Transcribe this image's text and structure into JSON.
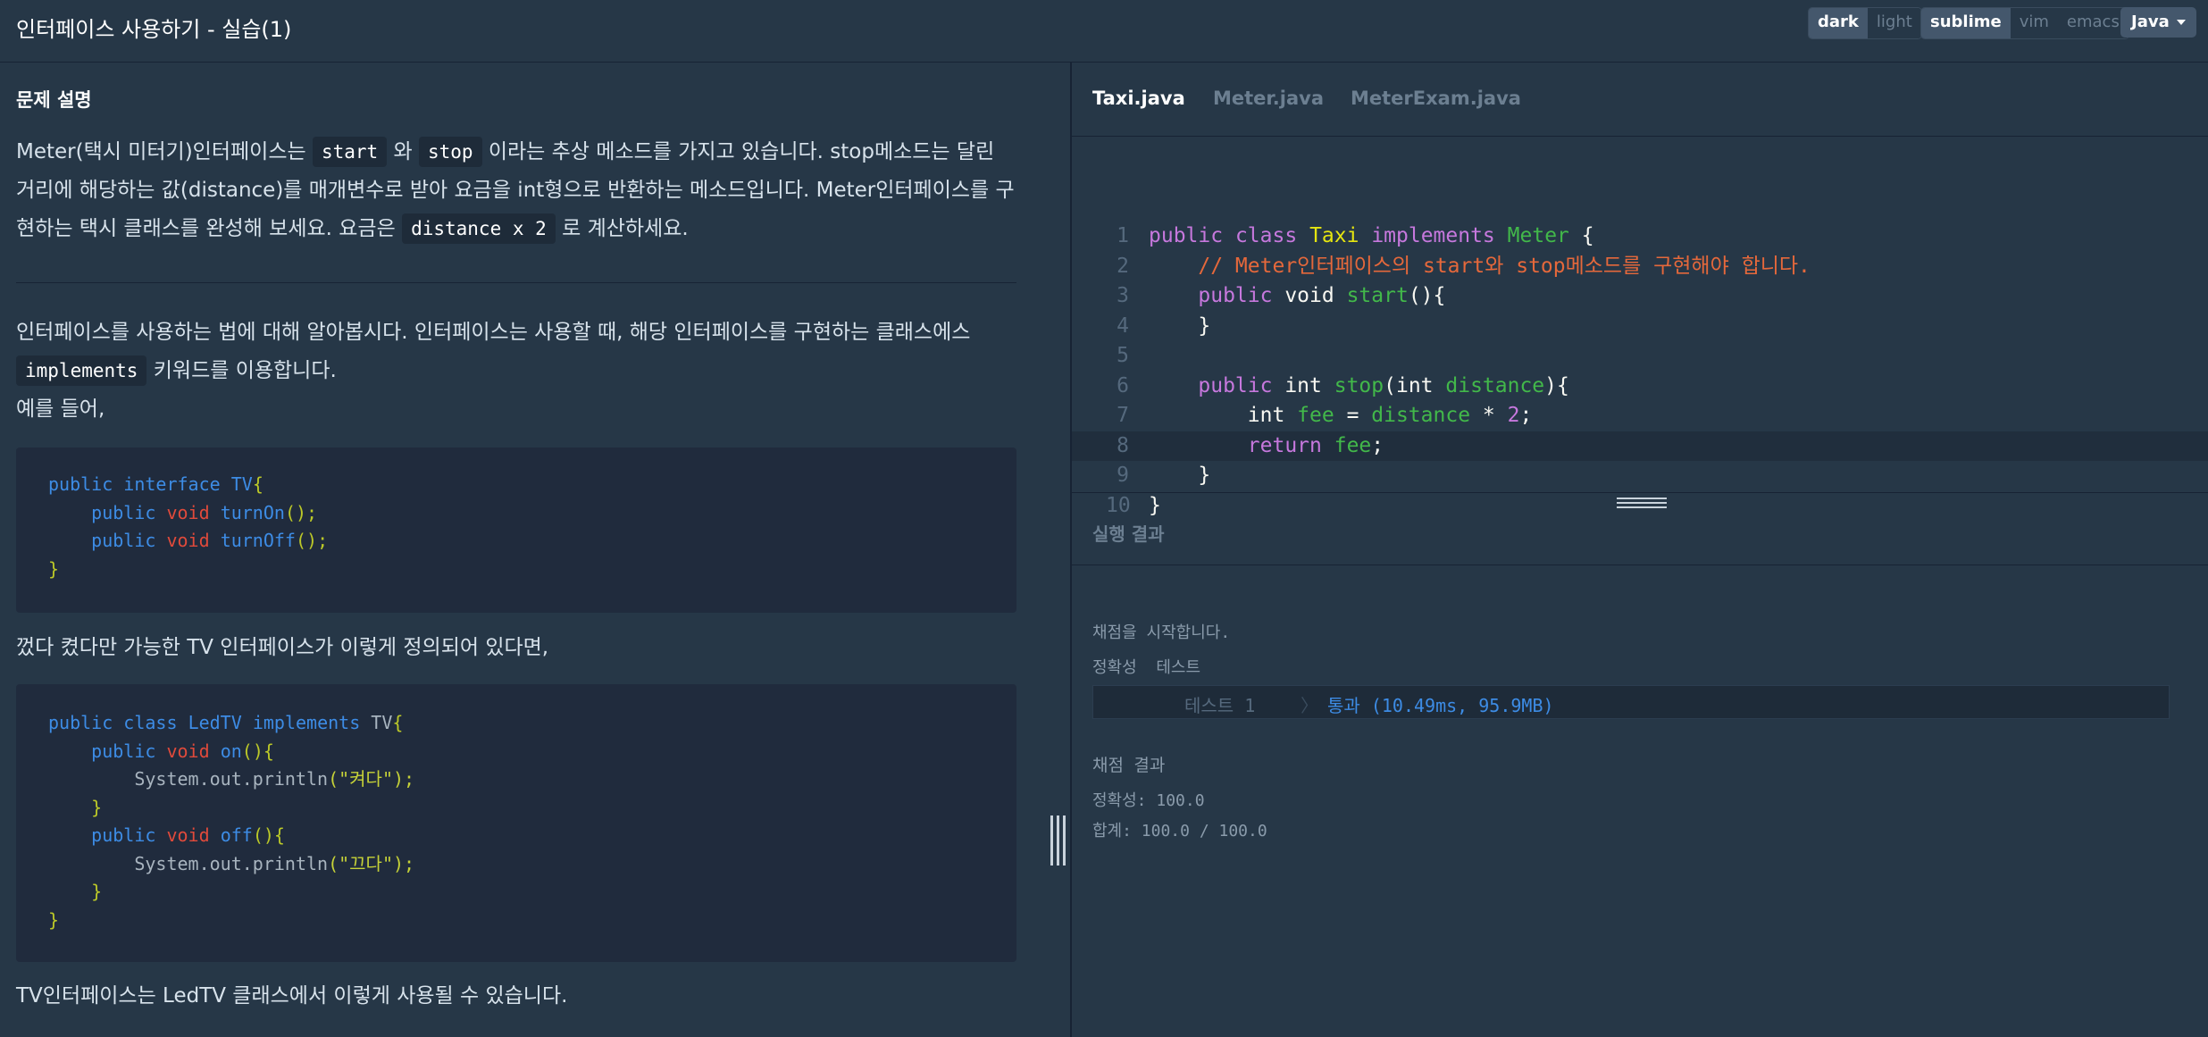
{
  "header": {
    "title": "인터페이스 사용하기 - 실습(1)",
    "theme_options": [
      "dark",
      "light"
    ],
    "keymap_options": [
      "sublime",
      "vim",
      "emacs"
    ],
    "language": "Java"
  },
  "description": {
    "heading": "문제 설명",
    "p1_a": "Meter(택시 미터기)인터페이스는 ",
    "p1_code1": "start",
    "p1_b": " 와 ",
    "p1_code2": "stop",
    "p1_c": " 이라는 추상 메소드를 가지고 있습니다. stop메소드는 달린 거리에 해당하는 값(distance)를 매개변수로 받아 요금을 int형으로 반환하는 메소드입니다. Meter인터페이스를 구현하는 택시 클래스를 완성해 보세요. 요금은 ",
    "p1_code3": "distance x 2",
    "p1_d": " 로 계산하세요.",
    "p2_a": "인터페이스를 사용하는 법에 대해 알아봅시다. 인터페이스는 사용할 때, 해당 인터페이스를 구현하는 클래스에스 ",
    "p2_code": "implements",
    "p2_b": " 키워드를 이용합니다.",
    "p3": "예를 들어,",
    "p4": "껐다 켰다만 가능한 TV 인터페이스가 이렇게 정의되어 있다면,",
    "p5": "TV인터페이스는 LedTV 클래스에서 이렇게 사용될 수 있습니다.",
    "code_tv": {
      "kw_public": "public",
      "kw_interface": "interface",
      "name": "TV",
      "brace_open": "{",
      "void": "void",
      "m1": "turnOn",
      "m2": "turnOff",
      "call": "();",
      "brace_close": "}"
    },
    "code_led": {
      "kw_public": "public",
      "kw_class": "class",
      "name": "LedTV",
      "kw_implements": "implements",
      "iface": "TV",
      "brace_open": "{",
      "void": "void",
      "m_on": "on",
      "m_off": "off",
      "sig": "(){",
      "println": "System.out.println",
      "str_on": "(\"켜다\");",
      "str_off": "(\"끄다\");",
      "brace_close": "}"
    }
  },
  "editor": {
    "tabs": [
      "Taxi.java",
      "Meter.java",
      "MeterExam.java"
    ],
    "line_numbers": [
      "1",
      "2",
      "3",
      "4",
      "5",
      "6",
      "7",
      "8",
      "9",
      "10"
    ],
    "l1": {
      "public": "public",
      "class": "class",
      "name": "Taxi",
      "implements": "implements",
      "iface": "Meter",
      "brace": " {"
    },
    "l2": {
      "comment": "// Meter인터페이스의 start와 stop메소드를 구현해야 합니다."
    },
    "l3": {
      "public": "public",
      "void": " void ",
      "fn": "start",
      "rest": "(){"
    },
    "l4": {
      "brace": "}"
    },
    "l6": {
      "public": "public",
      "int": " int ",
      "fn": "stop",
      "p1": "(int ",
      "arg": "distance",
      "p2": "){"
    },
    "l7": {
      "int": "int ",
      "var": "fee",
      "eq": " = ",
      "arg": "distance",
      "op": " * ",
      "num": "2",
      "semi": ";"
    },
    "l8": {
      "ret": "return ",
      "var": "fee",
      "semi": ";"
    },
    "l9": {
      "brace": "}"
    },
    "l10": {
      "brace": "}"
    }
  },
  "result": {
    "title": "실행 결과",
    "start_msg": "채점을 시작합니다.",
    "section_label": "정확성  테스트",
    "test_label": "테스트 1",
    "test_sep": "〉",
    "test_pass": "통과 (10.49ms, 95.9MB)",
    "score_heading": "채점 결과",
    "accuracy": "정확성: 100.0",
    "total": "합계: 100.0 / 100.0"
  }
}
